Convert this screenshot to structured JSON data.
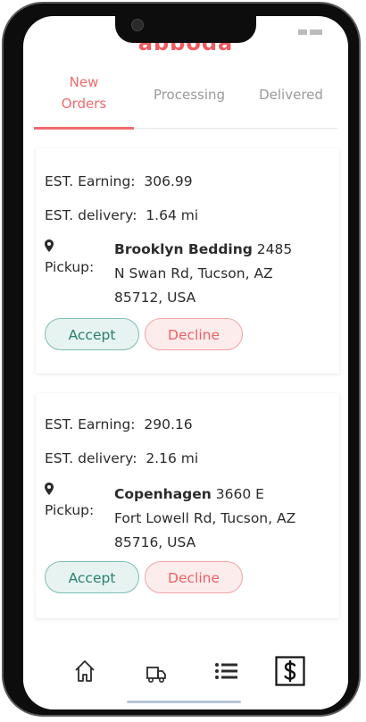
{
  "app": {
    "brand": "abboda"
  },
  "tabs": [
    {
      "label_line1": "New",
      "label_line2": "Orders",
      "active": true
    },
    {
      "label": "Processing",
      "active": false
    },
    {
      "label": "Delivered",
      "active": false
    }
  ],
  "orders": [
    {
      "earning_label": "EST. Earning:",
      "earning_value": "306.99",
      "delivery_label": "EST. delivery:",
      "delivery_value": "1.64 mi",
      "pickup_label": "Pickup:",
      "pickup_name": "Brooklyn Bedding",
      "pickup_line1": " 2485",
      "pickup_line2": "N Swan Rd, Tucson, AZ",
      "pickup_line3": "85712, USA",
      "accept_label": "Accept",
      "decline_label": "Decline"
    },
    {
      "earning_label": "EST. Earning:",
      "earning_value": "290.16",
      "delivery_label": "EST. delivery:",
      "delivery_value": "2.16 mi",
      "pickup_label": "Pickup:",
      "pickup_name": "Copenhagen",
      "pickup_line1": " 3660 E",
      "pickup_line2": "Fort Lowell Rd, Tucson, AZ",
      "pickup_line3": "85716, USA",
      "accept_label": "Accept",
      "decline_label": "Decline"
    }
  ],
  "bottom_nav": [
    {
      "icon": "home-icon"
    },
    {
      "icon": "truck-icon"
    },
    {
      "icon": "list-icon"
    },
    {
      "icon": "dollar-icon",
      "active": true
    }
  ],
  "colors": {
    "accent": "#f06a6e",
    "accept_text": "#2a7d70",
    "accept_bg": "#e6f3f1",
    "decline_text": "#ee6166",
    "decline_bg": "#fdecec"
  }
}
